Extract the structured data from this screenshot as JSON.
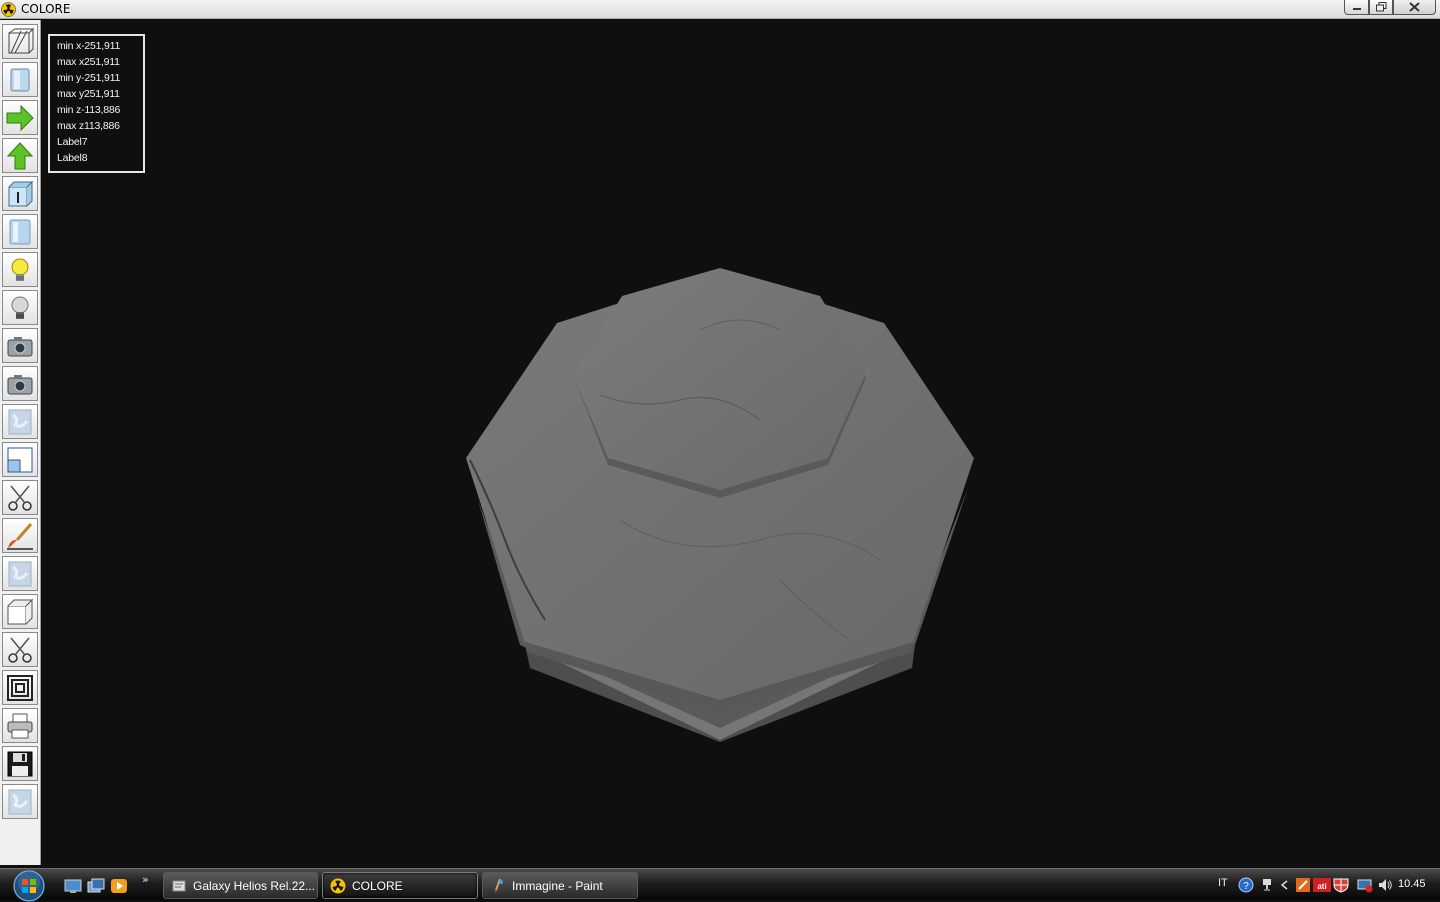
{
  "window": {
    "title": "COLORE"
  },
  "info_panel": {
    "lines": [
      "min x-251,911",
      "max x251,911",
      "min y-251,911",
      "max y251,911",
      "min z-113,886",
      "max z113,886",
      "Label7",
      "Label8"
    ]
  },
  "toolbar": {
    "tools": [
      {
        "icon": "wireframe-icon"
      },
      {
        "icon": "solid-cube-icon"
      },
      {
        "icon": "arrow-right-icon"
      },
      {
        "icon": "arrow-up-icon"
      },
      {
        "icon": "cube-info-icon"
      },
      {
        "icon": "glass-cube-icon"
      },
      {
        "icon": "light-on-icon"
      },
      {
        "icon": "light-off-icon"
      },
      {
        "icon": "camera-icon"
      },
      {
        "icon": "camera-2-icon"
      },
      {
        "icon": "texture-icon"
      },
      {
        "icon": "window-icon"
      },
      {
        "icon": "scissors-icon"
      },
      {
        "icon": "paintbrush-icon"
      },
      {
        "icon": "texture-2-icon"
      },
      {
        "icon": "white-cube-icon"
      },
      {
        "icon": "scissors-2-icon"
      },
      {
        "icon": "concentric-squares-icon"
      },
      {
        "icon": "printer-icon"
      },
      {
        "icon": "save-floppy-icon"
      },
      {
        "icon": "texture-3-icon"
      }
    ]
  },
  "taskbar": {
    "tasks": [
      {
        "label": "Galaxy Helios  Rel.22...",
        "icon": "galaxy-icon"
      },
      {
        "label": "COLORE",
        "icon": "radiation-icon",
        "active": true
      },
      {
        "label": "Immagine - Paint",
        "icon": "paint-icon"
      }
    ],
    "quicklaunch_more": "»",
    "tray": {
      "language": "IT",
      "clock": "10.45"
    }
  },
  "colors": {
    "viewport_bg": "#0f0f0f",
    "object_gray": "#6e6e6e"
  }
}
